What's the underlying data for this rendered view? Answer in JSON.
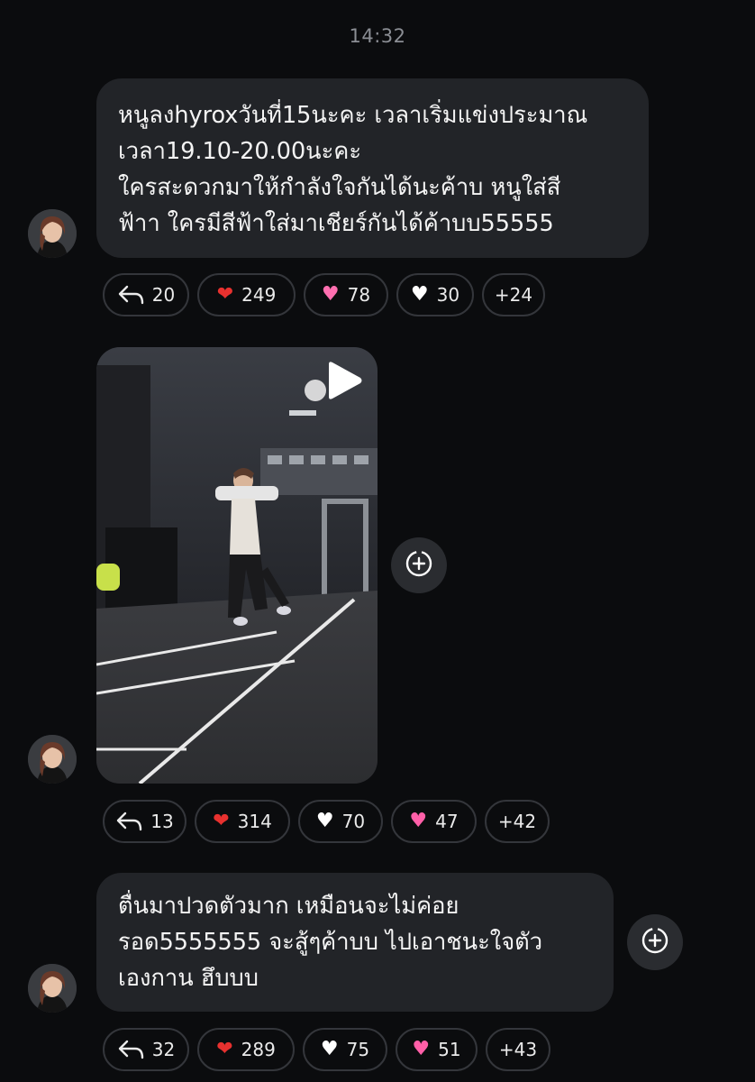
{
  "timestamp": "14:32",
  "messages": [
    {
      "text": "หนูลงhyroxวันที่15นะคะ เวลาเริ่มแข่งประมาณ\nเวลา19.10-20.00นะคะ\nใครสะดวกมาให้กำลังใจกันได้นะค้าบ หนูใส่สี\nฟ้าา ใครมีสีฟ้าใส่มาเชียร์กันได้ค้าบบ55555",
      "reactions": [
        {
          "icon": "reply-icon",
          "count": "20"
        },
        {
          "icon": "red-heart-icon",
          "emoji": "❤",
          "count": "249"
        },
        {
          "icon": "pink-heart-icon",
          "emoji": "♥",
          "count": "78"
        },
        {
          "icon": "white-heart-icon",
          "emoji": "♥",
          "count": "30"
        },
        {
          "more": "+24"
        }
      ]
    },
    {
      "media": "video",
      "reactions": [
        {
          "icon": "reply-icon",
          "count": "13"
        },
        {
          "icon": "red-heart-icon",
          "emoji": "❤",
          "count": "314"
        },
        {
          "icon": "white-heart-icon",
          "emoji": "♥",
          "count": "70"
        },
        {
          "icon": "sparkling-heart-icon",
          "emoji": "♥",
          "count": "47"
        },
        {
          "more": "+42"
        }
      ]
    },
    {
      "text": "ตื่นมาปวดตัวมาก เหมือนจะไม่ค่อย\nรอด5555555 จะสู้ๆค้าบบ ไปเอาชนะใจตัว\nเองกาน ฮึบบบ",
      "reactions": [
        {
          "icon": "reply-icon",
          "count": "32"
        },
        {
          "icon": "red-heart-icon",
          "emoji": "❤",
          "count": "289"
        },
        {
          "icon": "white-heart-icon",
          "emoji": "♥",
          "count": "75"
        },
        {
          "icon": "sparkling-heart-icon",
          "emoji": "♥",
          "count": "51"
        },
        {
          "more": "+43"
        }
      ]
    }
  ],
  "colors": {
    "background": "#0b0c0e",
    "bubble": "#222428",
    "pill_border": "#34363b",
    "red_heart": "#e8312f",
    "pink_heart": "#ff6fb0"
  }
}
